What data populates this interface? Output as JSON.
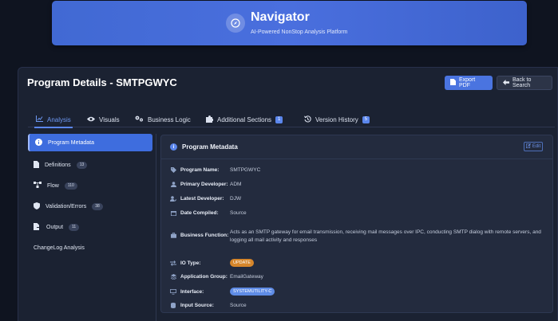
{
  "banner": {
    "title": "Navigator",
    "subtitle": "AI-Powered NonStop Analysis Platform",
    "icon": "compass-icon"
  },
  "page": {
    "title": "Program Details - SMTPGWYC",
    "export_label": "Export PDF",
    "back_label": "Back to Search"
  },
  "tabs": [
    {
      "label": "Analysis",
      "icon": "chart-icon",
      "active": true
    },
    {
      "label": "Visuals",
      "icon": "eye-icon"
    },
    {
      "label": "Business Logic",
      "icon": "gears-icon"
    },
    {
      "label": "Additional Sections",
      "icon": "puzzle-icon",
      "badge": "1"
    },
    {
      "label": "Version History",
      "icon": "history-icon",
      "badge": "5"
    }
  ],
  "sidebar": [
    {
      "label": "Program Metadata",
      "icon": "info-icon",
      "active": true
    },
    {
      "label": "Definitions",
      "icon": "file-icon",
      "count": "13"
    },
    {
      "label": "Flow",
      "icon": "flow-icon",
      "count": "110"
    },
    {
      "label": "Validation/Errors",
      "icon": "shield-icon",
      "count": "38"
    },
    {
      "label": "Output",
      "icon": "export-file-icon",
      "count": "11"
    },
    {
      "label": "ChangeLog Analysis",
      "icon": ""
    }
  ],
  "card": {
    "title": "Program Metadata",
    "edit_label": "Edit"
  },
  "metadata": {
    "program_name": {
      "label": "Program Name:",
      "value": "SMTPGWYC"
    },
    "primary_developer": {
      "label": "Primary Developer:",
      "value": "ADM"
    },
    "latest_developer": {
      "label": "Latest Developer:",
      "value": "DJW"
    },
    "date_compiled": {
      "label": "Date Compiled:",
      "value": "Source"
    },
    "business_function": {
      "label": "Business Function:",
      "value": "Acts as an SMTP gateway for email transmission, receiving mail messages over IPC, conducting SMTP dialog with remote servers, and logging all mail activity and responses"
    },
    "io_type": {
      "label": "IO Type:",
      "value": "UPDATE"
    },
    "application_group": {
      "label": "Application Group:",
      "value": "EmailGateway"
    },
    "interface": {
      "label": "Interface:",
      "value": "SYSTEMUTILITY-C"
    },
    "input_source": {
      "label": "Input Source:",
      "value": "Source"
    }
  },
  "colors": {
    "accent": "#4a74e0",
    "orange_badge": "#d6862b",
    "blue_badge": "#5f8ce6"
  }
}
